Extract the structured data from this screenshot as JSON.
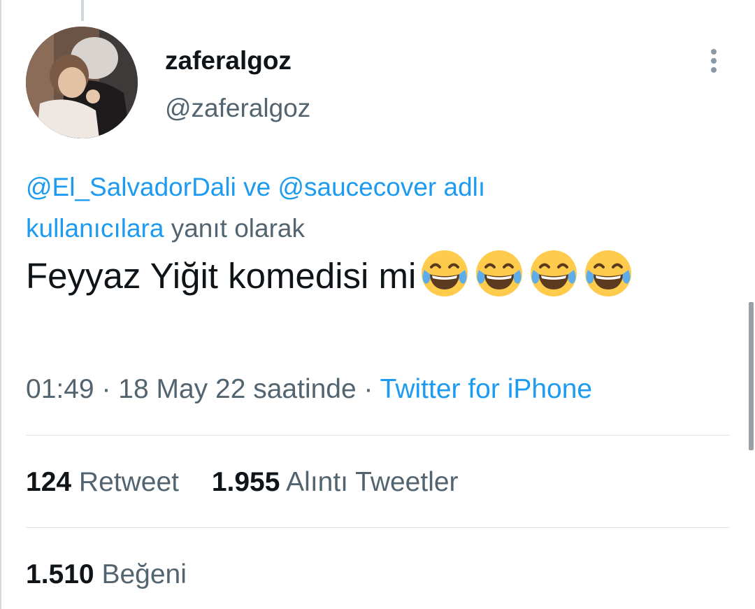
{
  "tweet": {
    "display_name": "zaferalgoz",
    "handle": "@zaferalgoz",
    "reply_context": {
      "mention_1": "@El_SalvadorDali",
      "conj": " ve ",
      "mention_2": "@saucecover",
      "mention_suffix": " adlı kullanıcılara",
      "suffix": " yanıt olarak"
    },
    "text": "Feyyaz Yiğit komedisi mi",
    "emoji": "face-with-tears-of-joy",
    "emoji_count": 4,
    "time": "01:49",
    "sep1": " · ",
    "date": "18 May 22 saatinde",
    "sep2": " · ",
    "source": "Twitter for iPhone"
  },
  "stats": {
    "retweets": {
      "count": "124",
      "label": "Retweet"
    },
    "quotes": {
      "count": "1.955",
      "label": "Alıntı Tweetler"
    },
    "likes": {
      "count": "1.510",
      "label": "Beğeni"
    }
  },
  "colors": {
    "link": "#1d9bf0",
    "secondary_text": "#536471",
    "primary_text": "#0f1419",
    "divider": "#dfe4e8"
  }
}
